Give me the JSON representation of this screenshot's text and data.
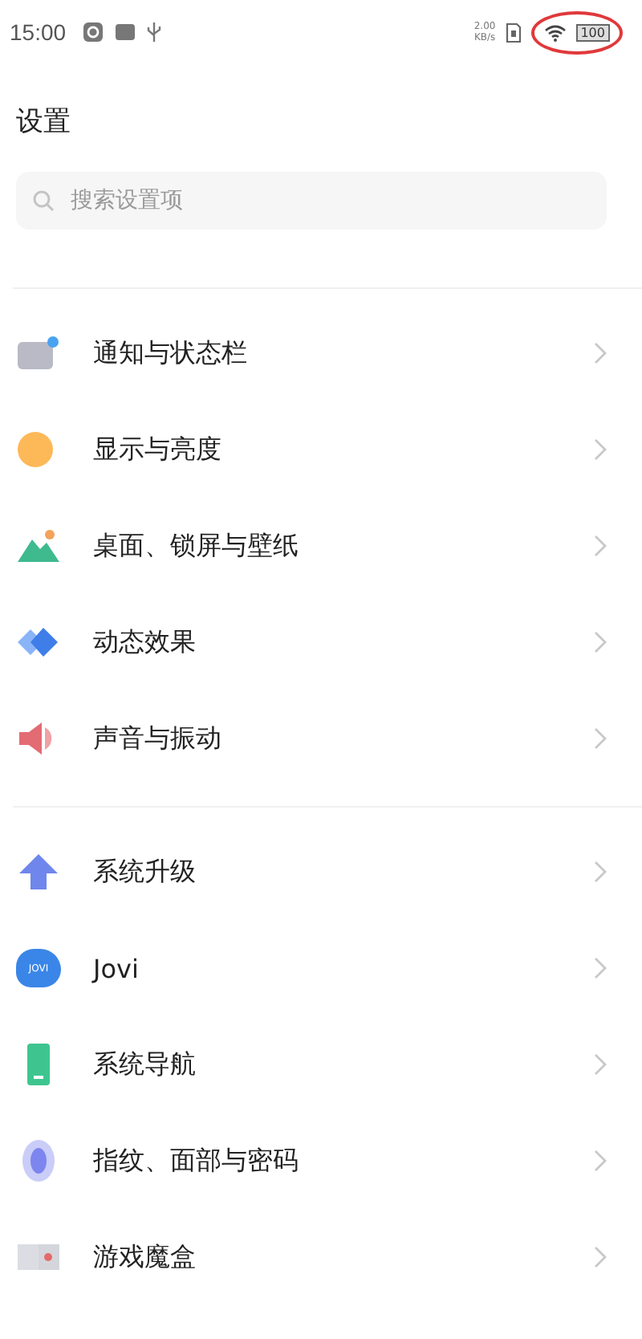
{
  "status_bar": {
    "time": "15:00",
    "speed_value": "2.00",
    "speed_unit": "KB/s",
    "battery": "100",
    "highlight_circle": true
  },
  "title": "设置",
  "search": {
    "placeholder": "搜索设置项"
  },
  "groups": [
    {
      "items": [
        {
          "kind": "notification",
          "label": "通知与状态栏"
        },
        {
          "kind": "display",
          "label": "显示与亮度"
        },
        {
          "kind": "wallpaper",
          "label": "桌面、锁屏与壁纸"
        },
        {
          "kind": "motion",
          "label": "动态效果"
        },
        {
          "kind": "sound",
          "label": "声音与振动"
        }
      ]
    },
    {
      "items": [
        {
          "kind": "upgrade",
          "label": "系统升级"
        },
        {
          "kind": "jovi",
          "label": "Jovi",
          "icon_text": "JOVI"
        },
        {
          "kind": "navigation",
          "label": "系统导航"
        },
        {
          "kind": "fingerprint",
          "label": "指纹、面部与密码"
        },
        {
          "kind": "game",
          "label": "游戏魔盒"
        }
      ]
    }
  ]
}
